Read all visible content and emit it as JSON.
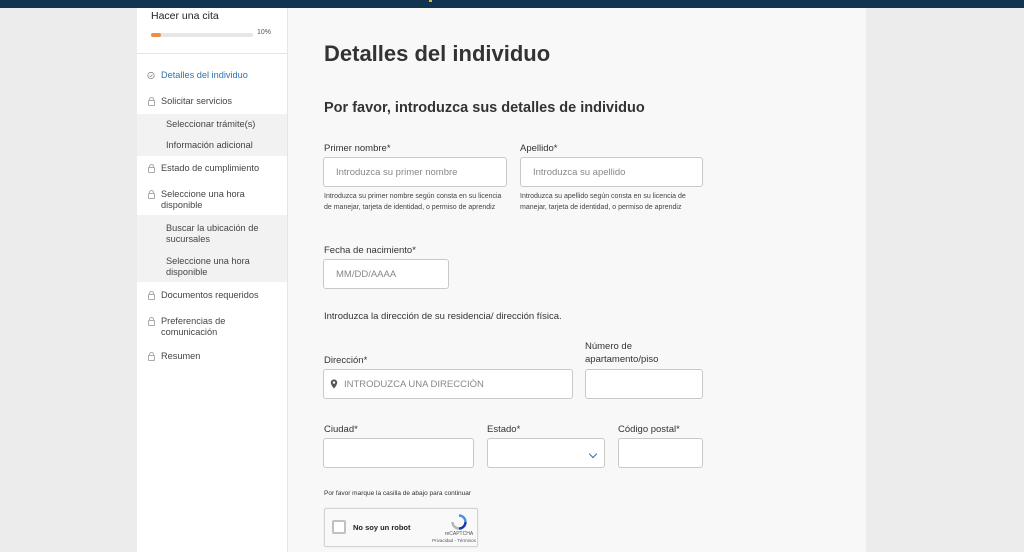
{
  "colors": {
    "topbar": "#0f3550",
    "accent": "#2b73b5",
    "progress": "#ee8e45"
  },
  "sidebar": {
    "title": "Hacer una cita",
    "progress_value": 10,
    "progress_text": "10%",
    "items": [
      {
        "label": "Detalles del individuo",
        "icon": "check-circle-icon",
        "active": true
      },
      {
        "label": "Solicitar servicios",
        "icon": "lock-icon"
      },
      {
        "label": "Estado de cumplimiento",
        "icon": "lock-icon"
      },
      {
        "label": "Seleccione una hora disponible",
        "icon": "lock-icon"
      },
      {
        "label": "Documentos requeridos",
        "icon": "lock-icon"
      },
      {
        "label": "Preferencias de comunicación",
        "icon": "lock-icon"
      },
      {
        "label": "Resumen",
        "icon": "lock-icon"
      }
    ],
    "subitems_servicios": [
      "Seleccionar trámite(s)",
      "Información adicional"
    ],
    "subitems_hora": [
      "Buscar la ubicación de sucursales",
      "Seleccione una hora disponible"
    ]
  },
  "main": {
    "title": "Detalles del individuo",
    "subtitle": "Por favor, introduzca sus detalles de individuo",
    "first_name": {
      "label": "Primer nombre*",
      "placeholder": "Introduzca su primer nombre",
      "help": "Introduzca su primer nombre según consta en su licencia de manejar, tarjeta de identidad, o permiso de aprendiz"
    },
    "last_name": {
      "label": "Apellido*",
      "placeholder": "Introduzca su apellido",
      "help": "Introduzca su apellido según consta en su licencia de manejar, tarjeta de identidad, o permiso de aprendiz"
    },
    "dob": {
      "label": "Fecha de nacimiento*",
      "placeholder": "MM/DD/AAAA"
    },
    "address_prompt": "Introduzca la dirección de su residencia/ dirección física.",
    "address": {
      "label": "Dirección*",
      "placeholder": "INTRODUZCA UNA DIRECCIÓN",
      "icon": "map-pin-icon"
    },
    "apartment": {
      "label": "Número de apartamento/piso",
      "value": ""
    },
    "city": {
      "label": "Ciudad*",
      "value": ""
    },
    "state": {
      "label": "Estado*",
      "value": ""
    },
    "zip": {
      "label": "Código postal*",
      "value": ""
    },
    "captcha_note": "Por favor marque la casilla de abajo para continuar",
    "captcha": {
      "label": "No soy un robot",
      "brand": "reCAPTCHA",
      "links": "Privacidad - Términos"
    }
  }
}
